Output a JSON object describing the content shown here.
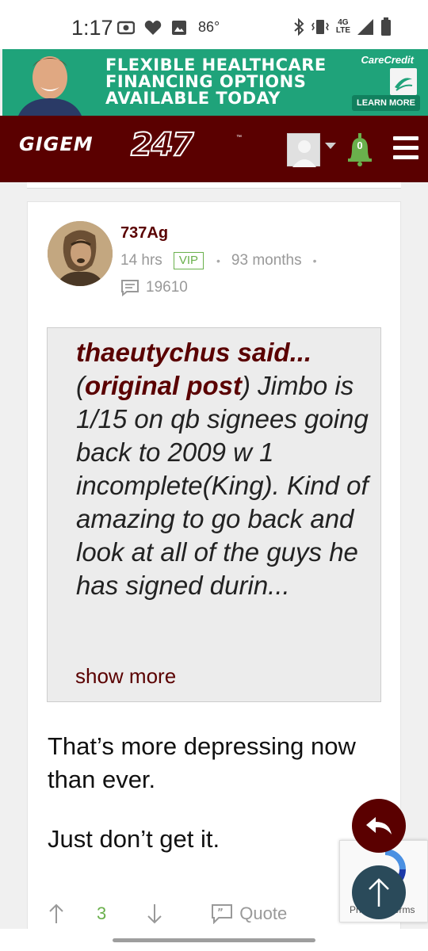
{
  "status_bar": {
    "time": "1:17",
    "temperature": "86°",
    "network_top": "4G",
    "network_bottom": "LTE"
  },
  "ad": {
    "headline_line1": "FLEXIBLE HEALTHCARE",
    "headline_line2": "FINANCING OPTIONS",
    "headline_line3": "AVAILABLE TODAY",
    "brand": "CareCredit",
    "cta": "LEARN MORE",
    "bg_color": "#1fa37a"
  },
  "header": {
    "logo_text": "GIGEM",
    "logo_number": "247",
    "logo_tm": "™",
    "notification_count": "0",
    "brand_color": "#5a0000"
  },
  "post": {
    "username": "737Ag",
    "time_ago": "14 hrs",
    "badge": "VIP",
    "membership": "93 months",
    "post_count": "19610",
    "quote": {
      "author_said": "thaeutychus said...",
      "original_post_label": "original post",
      "text": "Jimbo is 1/15 on qb signees going back to 2009 w 1 incomplete(King). Kind of amazing to go back and look at all of the guys he has signed durin...",
      "show_more": "show more"
    },
    "paragraph_1": "That’s more depressing now than ever.",
    "paragraph_2": "Just don’t get it.",
    "upvotes": "3",
    "quote_label": "Quote"
  },
  "recaptcha": {
    "label": "Privacy - Terms"
  }
}
